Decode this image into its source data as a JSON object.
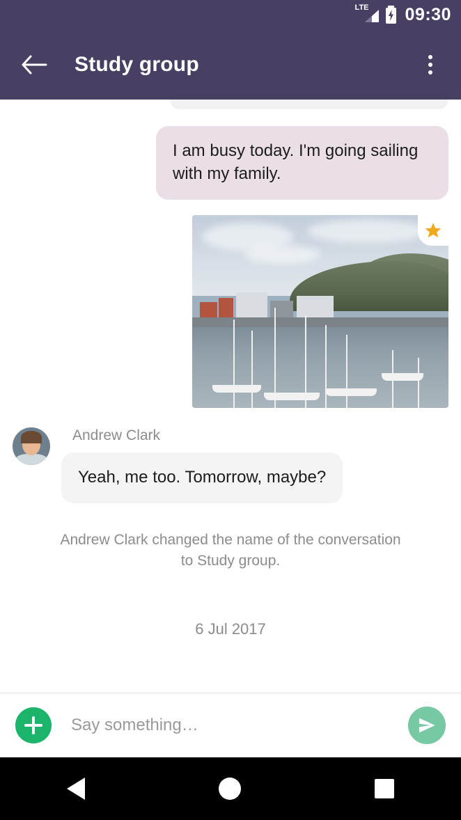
{
  "status_bar": {
    "network_label": "LTE",
    "clock": "09:30",
    "battery_icon": "battery-charging-icon",
    "signal_icon": "signal-bars-icon",
    "background_color": "#474063"
  },
  "app_bar": {
    "back_icon": "back-arrow-icon",
    "title": "Study group",
    "overflow_icon": "overflow-menu-icon",
    "background_color": "#474063"
  },
  "conversation": {
    "messages": [
      {
        "type": "outgoing-partial",
        "text": ""
      },
      {
        "type": "outgoing",
        "text": "I am busy today. I'm going sailing with my family."
      },
      {
        "type": "outgoing-image",
        "alt": "Harbour with sailing boats and hillside town",
        "starred": true,
        "star_icon": "star-icon"
      },
      {
        "type": "incoming",
        "sender": "Andrew Clark",
        "avatar": "contact-avatar",
        "text": "Yeah, me too. Tomorrow, maybe?"
      }
    ],
    "system_note": "Andrew Clark changed the name of the conversation to Study group.",
    "date_separator": "6 Jul 2017"
  },
  "composer": {
    "add_icon": "plus-icon",
    "input_value": "",
    "input_placeholder": "Say something…",
    "send_icon": "send-icon",
    "add_button_color": "#1cb36b",
    "send_button_color": "#77c9a4"
  },
  "nav_bar": {
    "back_icon": "nav-back-icon",
    "home_icon": "nav-home-icon",
    "recents_icon": "nav-recents-icon"
  }
}
